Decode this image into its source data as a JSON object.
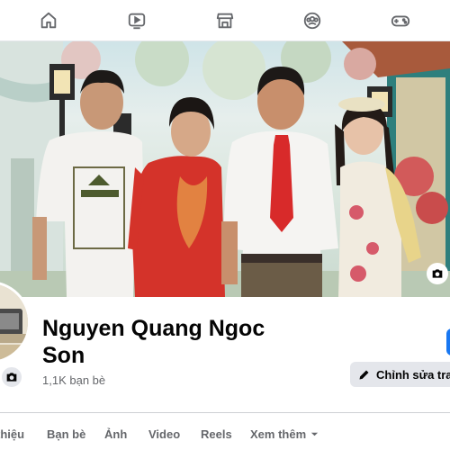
{
  "profile": {
    "name": "Nguyen Quang Ngoc Son",
    "friends": "1,1K bạn bè"
  },
  "actions": {
    "edit_label": "Chỉnh sửa trang"
  },
  "tabs": [
    {
      "label": "thiệu"
    },
    {
      "label": "Bạn bè"
    },
    {
      "label": "Ảnh"
    },
    {
      "label": "Video"
    },
    {
      "label": "Reels"
    },
    {
      "label": "Xem thêm"
    }
  ],
  "nav": {
    "icons": [
      "home-icon",
      "video-icon",
      "marketplace-icon",
      "groups-icon",
      "gaming-icon"
    ]
  },
  "colors": {
    "accent": "#1877f2",
    "muted_text": "#65676b",
    "button_bg": "#e4e6eb"
  }
}
